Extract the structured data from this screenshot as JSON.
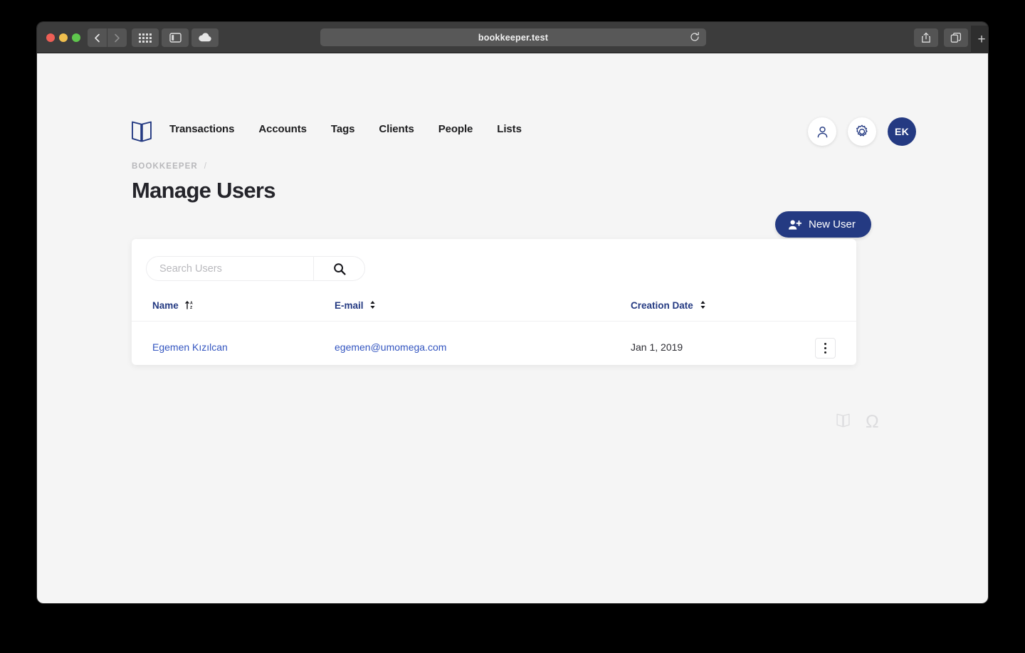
{
  "browser": {
    "url": "bookkeeper.test",
    "traffic_lights": [
      "close",
      "minimize",
      "maximize"
    ],
    "back_icon": "chevron-left-icon",
    "forward_icon": "chevron-right-icon",
    "tabs_overview_icon": "grid-icon",
    "sidebar_icon": "sidebar-icon",
    "cloud_icon": "cloud-icon",
    "reload_icon": "reload-icon",
    "share_icon": "share-icon",
    "duplicate_icon": "duplicate-icon",
    "new_tab_label": "+"
  },
  "header": {
    "logo_icon": "open-book-logo-icon",
    "nav": [
      {
        "label": "Transactions"
      },
      {
        "label": "Accounts"
      },
      {
        "label": "Tags"
      },
      {
        "label": "Clients"
      },
      {
        "label": "People"
      },
      {
        "label": "Lists"
      }
    ],
    "actions": {
      "profile_icon": "person-icon",
      "settings_icon": "gear-icon",
      "avatar_initials": "EK"
    }
  },
  "breadcrumb": {
    "root": "BOOKKEEPER",
    "separator": "/"
  },
  "page": {
    "title": "Manage Users"
  },
  "toolbar": {
    "new_user_label": "New User",
    "new_user_icon": "user-plus-icon"
  },
  "search": {
    "placeholder": "Search Users",
    "value": "",
    "button_icon": "search-icon"
  },
  "table": {
    "columns": [
      {
        "label": "Name",
        "sort_icon": "sort-alpha-up-icon"
      },
      {
        "label": "E-mail",
        "sort_icon": "sort-updown-icon"
      },
      {
        "label": "Creation Date",
        "sort_icon": "sort-updown-icon"
      }
    ],
    "rows": [
      {
        "name": "Egemen Kızılcan",
        "email": "egemen@umomega.com",
        "creation_date": "Jan 1, 2019",
        "menu_icon": "kebab-menu-icon"
      }
    ]
  },
  "footer": {
    "icons": [
      {
        "name": "open-book-icon"
      },
      {
        "name": "omega-icon",
        "glyph": "Ω"
      }
    ]
  },
  "colors": {
    "brand_navy": "#243a82",
    "link_blue": "#3355c0",
    "page_bg": "#f5f5f5",
    "card_bg": "#ffffff",
    "chrome_bg": "#3c3c3c",
    "muted_text": "#b8b8bb"
  }
}
